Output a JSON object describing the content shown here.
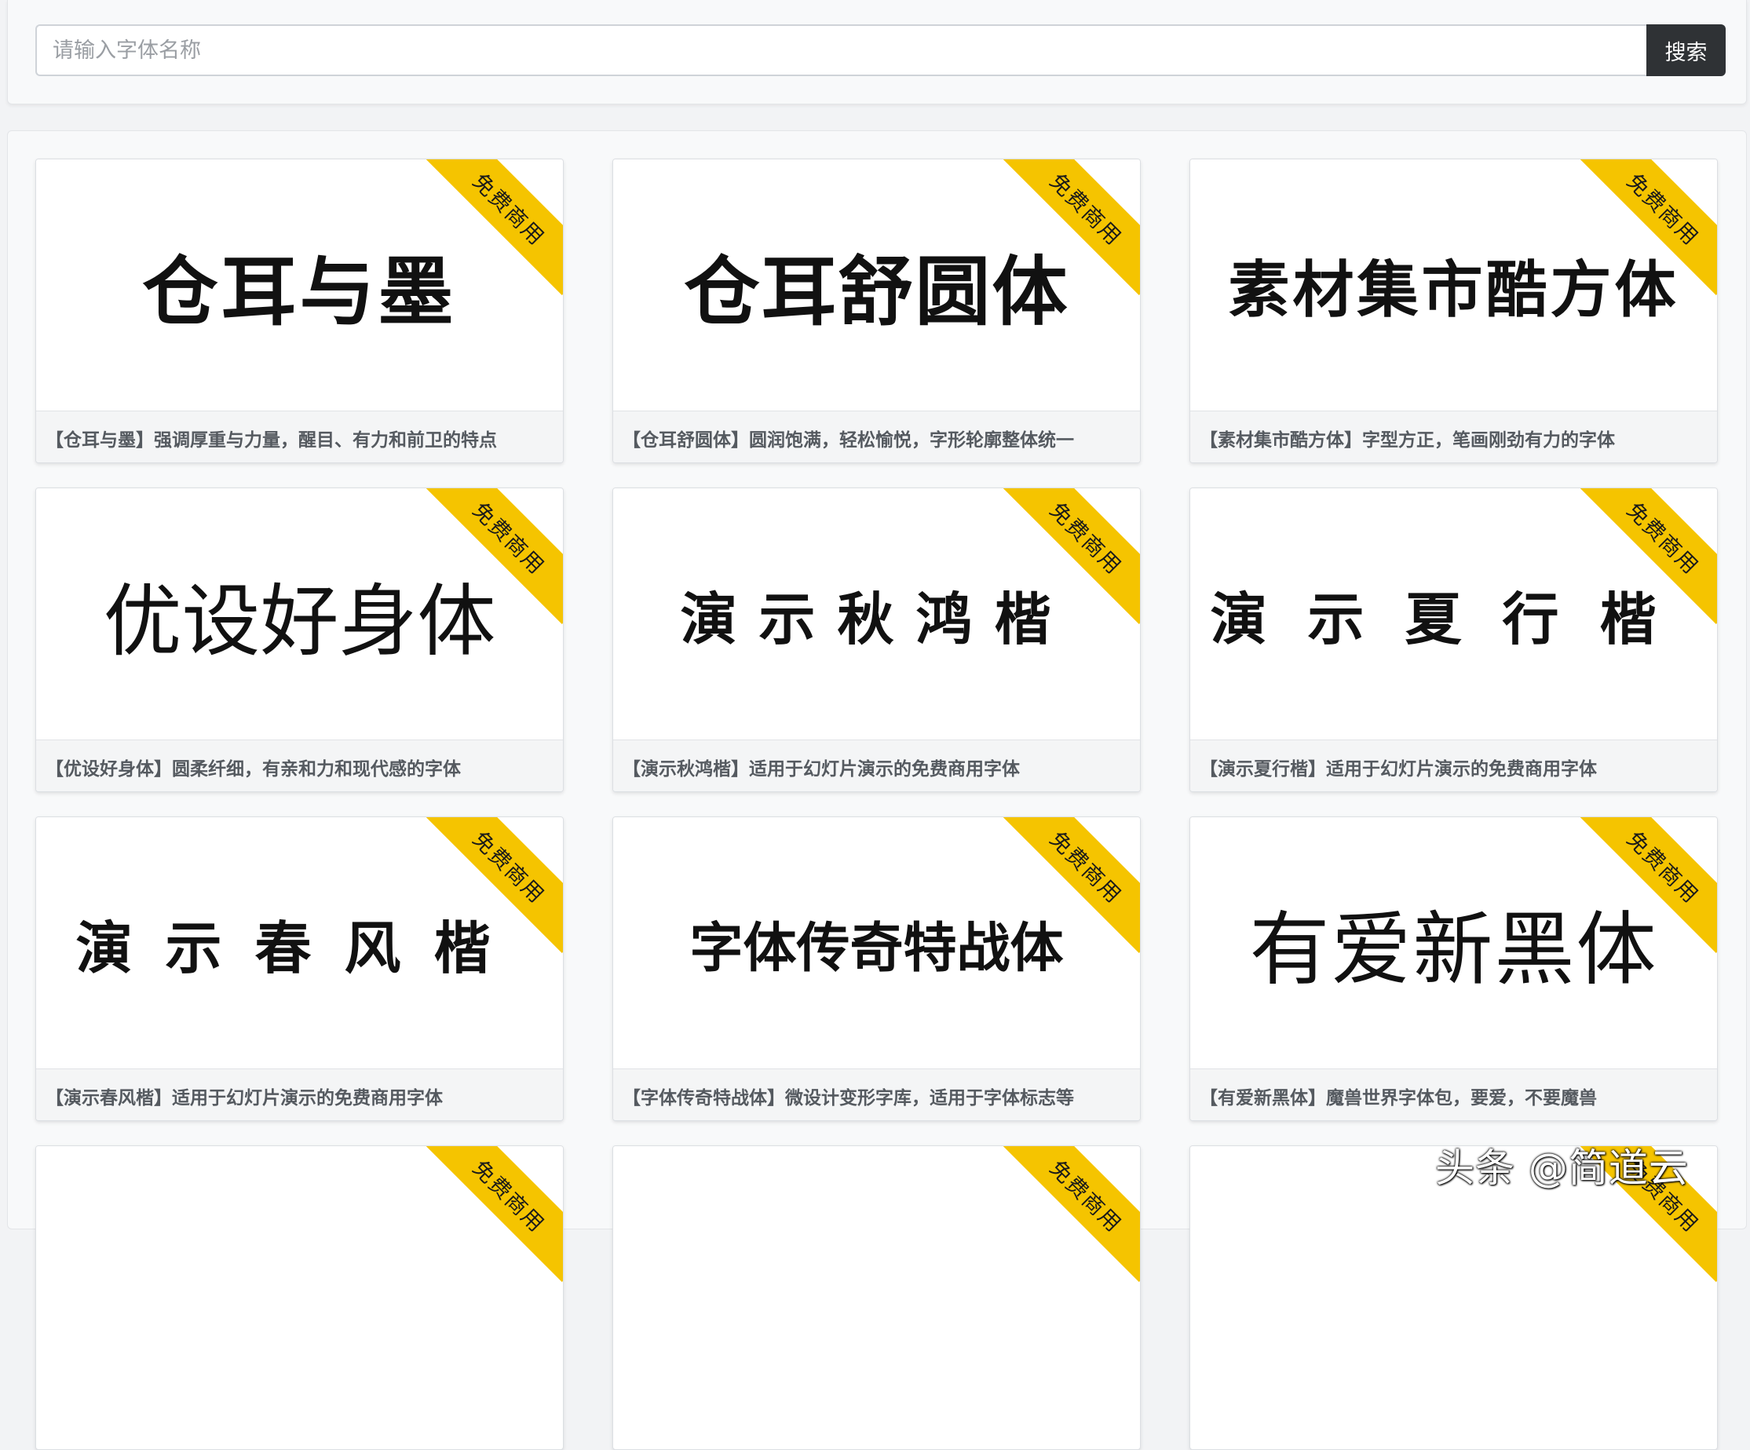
{
  "search": {
    "placeholder": "请输入字体名称",
    "value": "",
    "button_label": "搜索"
  },
  "cards": [
    {
      "preview": "仓耳与墨",
      "ribbon": "免费商用",
      "caption": "【仓耳与墨】强调厚重与力量，醒目、有力和前卫的特点"
    },
    {
      "preview": "仓耳舒圆体",
      "ribbon": "免费商用",
      "caption": "【仓耳舒圆体】圆润饱满，轻松愉悦，字形轮廓整体统一"
    },
    {
      "preview": "素材集市酷方体",
      "ribbon": "免费商用",
      "caption": "【素材集市酷方体】字型方正，笔画刚劲有力的字体"
    },
    {
      "preview": "优设好身体",
      "ribbon": "免费商用",
      "caption": "【优设好身体】圆柔纤细，有亲和力和现代感的字体"
    },
    {
      "preview": "演示秋鸿楷",
      "ribbon": "免费商用",
      "caption": "【演示秋鸿楷】适用于幻灯片演示的免费商用字体"
    },
    {
      "preview": "演示夏行楷",
      "ribbon": "免费商用",
      "caption": "【演示夏行楷】适用于幻灯片演示的免费商用字体"
    },
    {
      "preview": "演示春风楷",
      "ribbon": "免费商用",
      "caption": "【演示春风楷】适用于幻灯片演示的免费商用字体"
    },
    {
      "preview": "字体传奇特战体",
      "ribbon": "免费商用",
      "caption": "【字体传奇特战体】微设计变形字库，适用于字体标志等"
    },
    {
      "preview": "有爱新黑体",
      "ribbon": "免费商用",
      "caption": "【有爱新黑体】魔兽世界字体包，要爱，不要魔兽"
    },
    {
      "preview": "",
      "ribbon": "免费商用",
      "caption": ""
    },
    {
      "preview": "",
      "ribbon": "免费商用",
      "caption": ""
    },
    {
      "preview": "",
      "ribbon": "免费商用",
      "caption": ""
    }
  ],
  "watermark": "头条 @简道云",
  "colors": {
    "ribbon": "#f5c400",
    "search_button": "#2f3235",
    "page_background": "#f2f3f5"
  }
}
